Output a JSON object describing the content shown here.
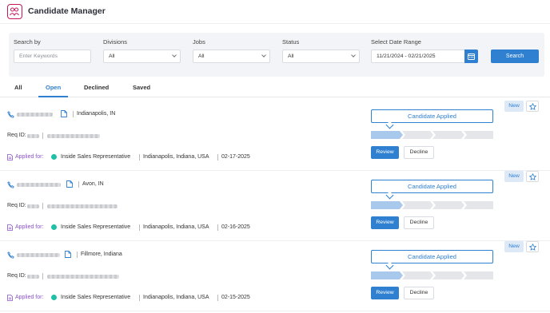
{
  "app": {
    "title": "Candidate Manager"
  },
  "filters": {
    "search": {
      "label": "Search by",
      "placeholder": "Enter Keywords"
    },
    "divisions": {
      "label": "Divisions",
      "value": "All"
    },
    "jobs": {
      "label": "Jobs",
      "value": "All"
    },
    "status": {
      "label": "Status",
      "value": "All"
    },
    "date_range": {
      "label": "Select Date Range",
      "value": "11/21/2024 - 02/21/2025"
    },
    "search_button": "Search"
  },
  "tabs": [
    {
      "label": "All"
    },
    {
      "label": "Open"
    },
    {
      "label": "Declined"
    },
    {
      "label": "Saved"
    }
  ],
  "active_tab": "Open",
  "candidates": [
    {
      "location": "Indianapolis, IN",
      "req_label": "Req ID:",
      "applied_label": "Applied for:",
      "job_title": "Inside Sales Representative",
      "job_location": "Indianapolis, Indiana, USA",
      "date": "02-17-2025",
      "status": "Candidate Applied",
      "review": "Review",
      "decline": "Decline",
      "badge": "New"
    },
    {
      "location": "Avon, IN",
      "req_label": "Req ID:",
      "applied_label": "Applied for:",
      "job_title": "Inside Sales Representative",
      "job_location": "Indianapolis, Indiana, USA",
      "date": "02-16-2025",
      "status": "Candidate Applied",
      "review": "Review",
      "decline": "Decline",
      "badge": "New"
    },
    {
      "location": "Fillmore, Indiana",
      "req_label": "Req ID:",
      "applied_label": "Applied for:",
      "job_title": "Inside Sales Representative",
      "job_location": "Indianapolis, Indiana, USA",
      "date": "02-15-2025",
      "status": "Candidate Applied",
      "review": "Review",
      "decline": "Decline",
      "badge": "New"
    }
  ],
  "colors": {
    "accent": "#2f80d1",
    "applied_label": "#8a53c9",
    "job_dot": "#1fbfa8",
    "logo": "#c2185b"
  },
  "icons": [
    "logo-icon",
    "calendar-icon",
    "phone-icon",
    "document-icon",
    "star-icon",
    "chevron-down-icon"
  ]
}
